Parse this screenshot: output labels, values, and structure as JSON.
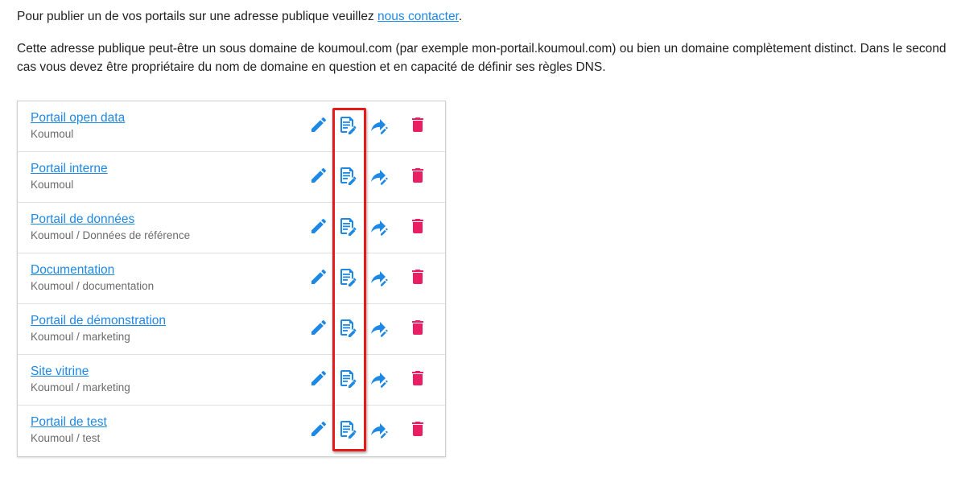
{
  "intro": {
    "p1_before": "Pour publier un de vos portails sur une adresse publique veuillez ",
    "p1_link": "nous contacter",
    "p1_after": ".",
    "p2": "Cette adresse publique peut-être un sous domaine de koumoul.com (par exemple mon-portail.koumoul.com) ou bien un domaine complètement distinct. Dans le second cas vous devez être propriétaire du nom de domaine en question et en capacité de définir ses règles DNS."
  },
  "portals": [
    {
      "title": "Portail open data",
      "subtitle": "Koumoul"
    },
    {
      "title": "Portail interne",
      "subtitle": "Koumoul"
    },
    {
      "title": "Portail de données",
      "subtitle": "Koumoul / Données de référence"
    },
    {
      "title": "Documentation",
      "subtitle": "Koumoul / documentation"
    },
    {
      "title": "Portail de démonstration",
      "subtitle": "Koumoul / marketing"
    },
    {
      "title": "Site vitrine",
      "subtitle": "Koumoul / marketing"
    },
    {
      "title": "Portail de test",
      "subtitle": "Koumoul / test"
    }
  ],
  "actions": {
    "edit_icon": "pencil-icon",
    "config_icon": "file-document-edit-icon",
    "share_icon": "share-icon",
    "delete_icon": "trash-icon"
  },
  "colors": {
    "link": "#1e88e5",
    "action": "#1e88e5",
    "delete": "#e91e63",
    "highlight": "#e51a1a"
  }
}
